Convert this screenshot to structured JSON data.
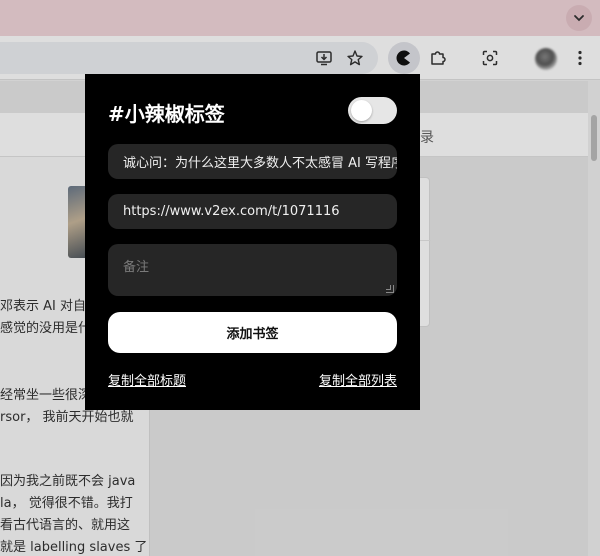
{
  "popup": {
    "title": "#小辣椒标签",
    "enabled": false,
    "bookmark_title": "诚心问：为什么这里大多数人不太感冒 AI 写程序",
    "bookmark_url": "https://www.v2ex.com/t/1071116",
    "note_placeholder": "备注",
    "add_button": "添加书签",
    "copy_titles_link": "复制全部标题",
    "copy_list_link": "复制全部列表"
  },
  "page": {
    "nav_tail": "录",
    "text_lines": [
      "邓表示 AI 对自己",
      "感觉的没用是什",
      "经常坐一些很深",
      "rsor， 我前天开始也就",
      "因为我之前既不会 java",
      "la， 觉得很不错。我打",
      "看古代语言的、就用这",
      "就是 labelling slaves 了"
    ]
  },
  "icons": {
    "tab_menu": "chevron-down-icon",
    "install": "install-app-icon",
    "bookmark": "star-icon",
    "extension_active": "pacman-extension-icon",
    "extensions": "puzzle-icon",
    "lens": "lens-icon",
    "menu": "kebab-menu-icon"
  },
  "colors": {
    "popup_bg": "#000000",
    "field_bg": "#262626",
    "button_bg": "#ffffff",
    "tabstrip": "#f3d7dc"
  }
}
